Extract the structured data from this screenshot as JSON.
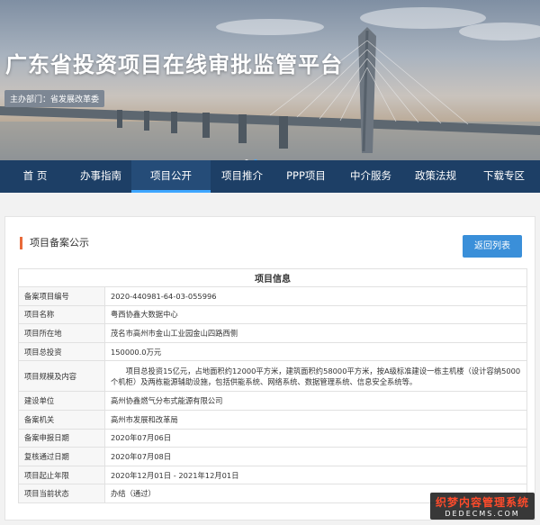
{
  "header": {
    "title": "广东省投资项目在线审批监管平台",
    "sponsor": "主办部门：省发展改革委"
  },
  "nav": {
    "items": [
      "首 页",
      "办事指南",
      "项目公开",
      "项目推介",
      "PPP项目",
      "中介服务",
      "政策法规",
      "下载专区"
    ],
    "active_index": 2
  },
  "card": {
    "title": "项目备案公示",
    "back_label": "返回列表"
  },
  "table": {
    "heading": "项目信息",
    "rows": [
      {
        "label": "备案项目编号",
        "value": "2020-440981-64-03-055996"
      },
      {
        "label": "项目名称",
        "value": "粤西协鑫大数据中心"
      },
      {
        "label": "项目所在地",
        "value": "茂名市高州市金山工业园金山四路西侧"
      },
      {
        "label": "项目总投资",
        "value": "150000.0万元"
      },
      {
        "label": "项目规模及内容",
        "value": "项目总投资15亿元，占地面积约12000平方米，建筑面积约58000平方米，按A级标准建设一栋主机楼（设计容纳5000个机柜）及两栋能源辅助设施，包括供能系统、网络系统、数据管理系统、信息安全系统等。"
      },
      {
        "label": "建设单位",
        "value": "高州协鑫燃气分布式能源有限公司"
      },
      {
        "label": "备案机关",
        "value": "高州市发展和改革局"
      },
      {
        "label": "备案申报日期",
        "value": "2020年07月06日"
      },
      {
        "label": "复核通过日期",
        "value": "2020年07月08日"
      },
      {
        "label": "项目起止年限",
        "value": "2020年12月01日 - 2021年12月01日"
      },
      {
        "label": "项目当前状态",
        "value": "办结（通过）"
      }
    ]
  },
  "watermark": {
    "line1": "织梦内容管理系统",
    "line2": "DEDECMS.COM"
  },
  "colors": {
    "nav_bg": "#1d3f66",
    "accent_blue": "#3a8fd9",
    "title_mark": "#e86a3a"
  }
}
